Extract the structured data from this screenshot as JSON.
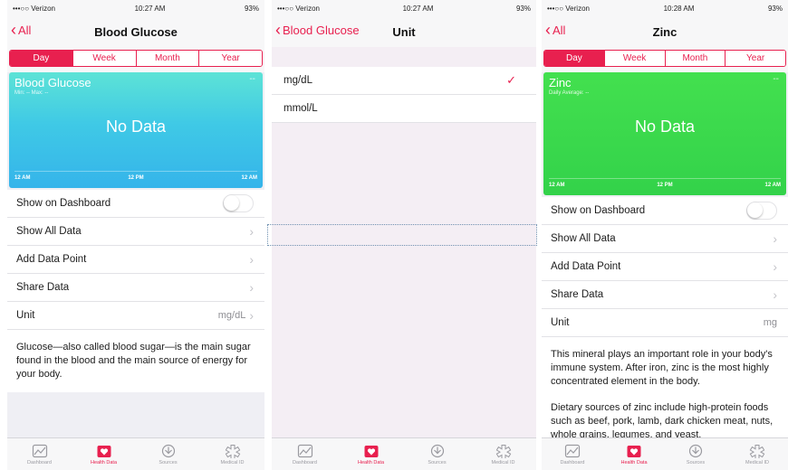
{
  "tabs": [
    "Dashboard",
    "Health Data",
    "Sources",
    "Medical ID"
  ],
  "colors": {
    "accent": "#e8204f",
    "teal": "#3fc9e6",
    "green": "#33d24a"
  },
  "screen1": {
    "status": {
      "carrier": "•••○○ Verizon",
      "time": "10:27 AM",
      "battery": "93%"
    },
    "back_label": "All",
    "title": "Blood Glucose",
    "segments": [
      "Day",
      "Week",
      "Month",
      "Year"
    ],
    "card": {
      "title": "Blood Glucose",
      "sub": "Min: --  Max: --",
      "dash": "--",
      "empty": "No Data",
      "axis": [
        "12 AM",
        "12 PM",
        "12 AM"
      ]
    },
    "rows": {
      "dashboard": "Show on Dashboard",
      "all_data": "Show All Data",
      "add_point": "Add Data Point",
      "share": "Share Data",
      "unit": "Unit",
      "unit_value": "mg/dL"
    },
    "description": "Glucose—also called blood sugar—is the main sugar found in the blood and the main source of energy for your body."
  },
  "screen2": {
    "status": {
      "carrier": "•••○○ Verizon",
      "time": "10:27 AM",
      "battery": "93%"
    },
    "back_label": "Blood Glucose",
    "title": "Unit",
    "units": [
      "mg/dL",
      "mmol/L"
    ],
    "selected_unit": "mg/dL"
  },
  "screen3": {
    "status": {
      "carrier": "•••○○ Verizon",
      "time": "10:28 AM",
      "battery": "93%"
    },
    "back_label": "All",
    "title": "Zinc",
    "segments": [
      "Day",
      "Week",
      "Month",
      "Year"
    ],
    "card": {
      "title": "Zinc",
      "sub": "Daily Average: --",
      "dash": "--",
      "empty": "No Data",
      "axis": [
        "12 AM",
        "12 PM",
        "12 AM"
      ]
    },
    "rows": {
      "dashboard": "Show on Dashboard",
      "all_data": "Show All Data",
      "add_point": "Add Data Point",
      "share": "Share Data",
      "unit": "Unit",
      "unit_value": "mg"
    },
    "description1": "This mineral plays an important role in your body's immune system. After iron, zinc is the most highly concentrated element in the body.",
    "description2": "Dietary sources of zinc include high-protein foods such as beef, pork, lamb, dark chicken meat, nuts, whole grains, legumes, and yeast."
  }
}
